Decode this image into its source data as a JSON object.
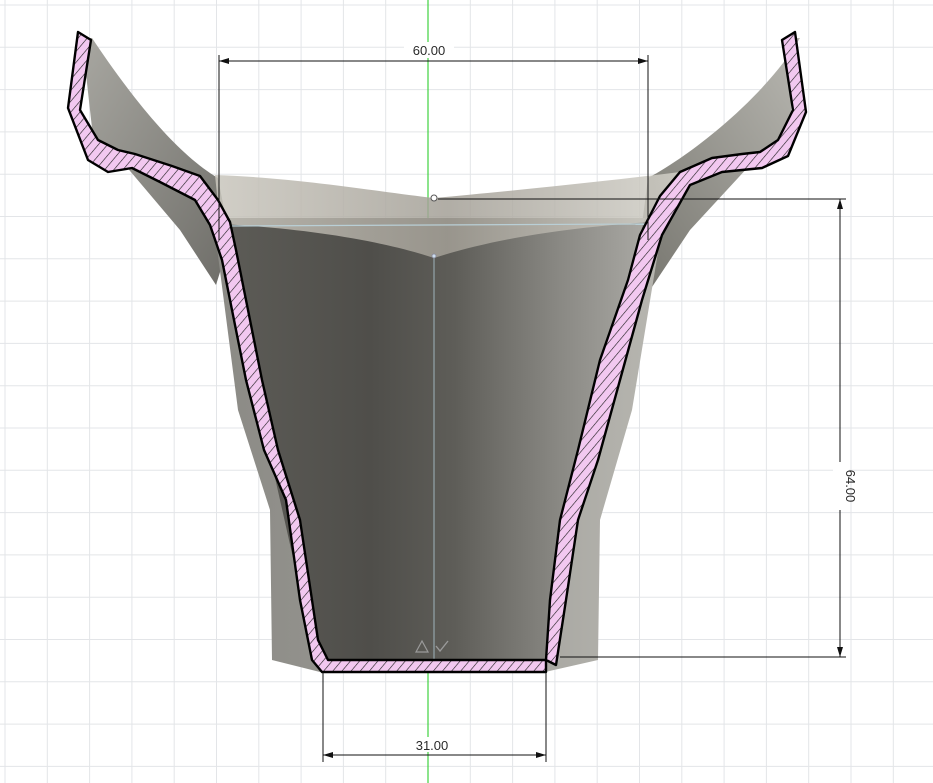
{
  "view": {
    "background": "#ffffff",
    "grid_color": "#e3e5e8",
    "axis_color": "#3fd13f",
    "body_color": "#6b6a64",
    "section_fill": "#f2c8f0",
    "outline_color": "#000000",
    "dimension_color": "#111111"
  },
  "dimensions": {
    "top_width": {
      "label": "60.00"
    },
    "height": {
      "label": "64.00"
    },
    "bottom_width": {
      "label": "31.00"
    }
  },
  "icons": [
    "warning-triangle-icon",
    "check-icon"
  ]
}
